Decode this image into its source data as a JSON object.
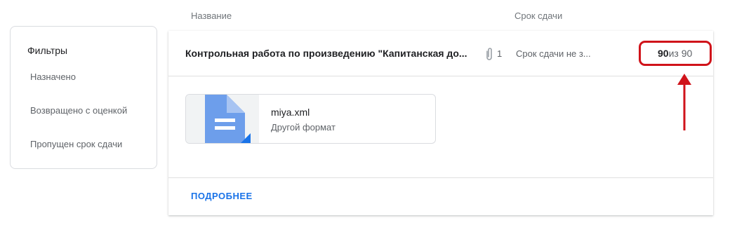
{
  "headers": {
    "name": "Название",
    "due": "Срок сдачи"
  },
  "filters": {
    "title": "Фильтры",
    "items": [
      {
        "label": "Назначено"
      },
      {
        "label": "Возвращено с оценкой"
      },
      {
        "label": "Пропущен срок сдачи"
      }
    ]
  },
  "assignment": {
    "title": "Контрольная работа по произведению \"Капитанская до...",
    "attachments_count": "1",
    "due": "Срок сдачи не з...",
    "grade": {
      "score": "90",
      "of": "из",
      "max": "90"
    }
  },
  "attachment": {
    "file_name": "miya.xml",
    "file_type": "Другой формат"
  },
  "more_label": "ПОДРОБНЕЕ",
  "colors": {
    "annotation": "#d0131a",
    "link": "#1a73e8",
    "doc_icon": "#6d9eeb"
  },
  "icons": {
    "attachment": "paperclip-icon",
    "file": "document-icon"
  }
}
